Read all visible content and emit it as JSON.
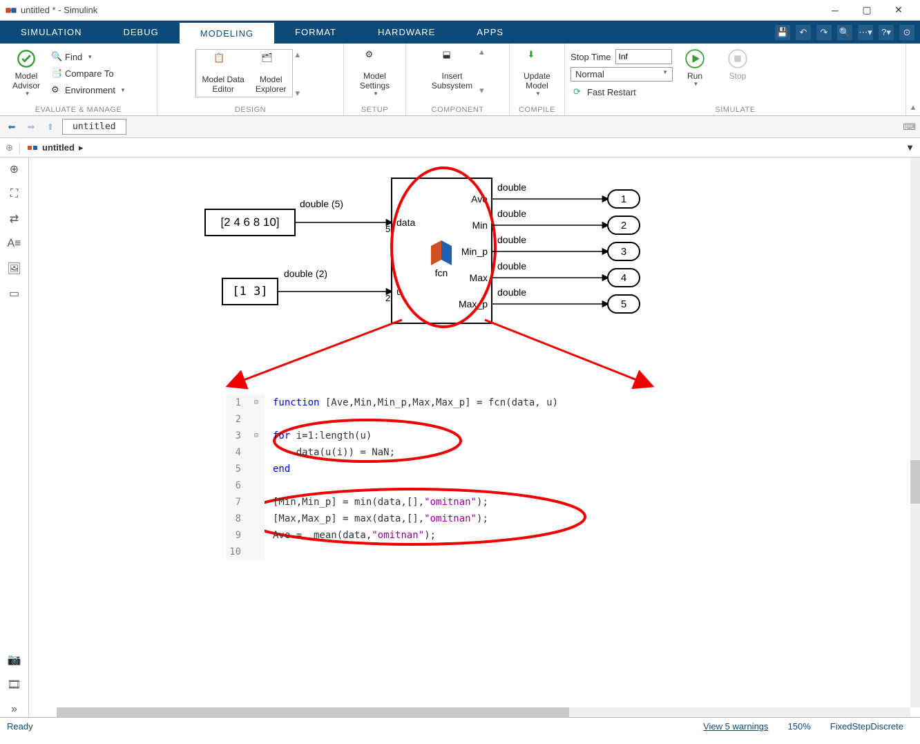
{
  "window": {
    "title": "untitled * - Simulink"
  },
  "tabs": [
    "SIMULATION",
    "DEBUG",
    "MODELING",
    "FORMAT",
    "HARDWARE",
    "APPS"
  ],
  "activeTab": "MODELING",
  "ribbon": {
    "evaluate": {
      "model_advisor": "Model\nAdvisor",
      "find": "Find",
      "compare": "Compare To",
      "environment": "Environment",
      "label": "EVALUATE & MANAGE"
    },
    "design": {
      "data_editor": "Model Data\nEditor",
      "explorer": "Model\nExplorer",
      "label": "DESIGN"
    },
    "setup": {
      "settings": "Model\nSettings",
      "label": "SETUP"
    },
    "component": {
      "insert": "Insert\nSubsystem",
      "label": "COMPONENT"
    },
    "compile": {
      "update": "Update\nModel",
      "label": "COMPILE"
    },
    "simulate": {
      "stoptime_label": "Stop Time",
      "stoptime_val": "Inf",
      "mode": "Normal",
      "fast": "Fast Restart",
      "run": "Run",
      "stop": "Stop",
      "label": "SIMULATE"
    }
  },
  "nav": {
    "tab": "untitled"
  },
  "breadcrumb": {
    "model": "untitled"
  },
  "diagram": {
    "const1": "[2 4 6 8 10]",
    "const1_sig": "double (5)",
    "const2": "[1 3]",
    "const2_sig": "double (2)",
    "fcn_name": "fcn",
    "in_labels": [
      "data",
      "u"
    ],
    "in_sizes": [
      "5",
      "2"
    ],
    "out_labels": [
      "Ave",
      "Min",
      "Min_p",
      "Max",
      "Max_p"
    ],
    "out_sig": "double",
    "outports": [
      "1",
      "2",
      "3",
      "4",
      "5"
    ]
  },
  "code": {
    "lines": [
      {
        "n": "1",
        "fold": "⊟",
        "t": "function [Ave,Min,Min_p,Max,Max_p] = fcn(data, u)"
      },
      {
        "n": "2",
        "fold": "",
        "t": ""
      },
      {
        "n": "3",
        "fold": "⊟",
        "t": "for i=1:length(u)"
      },
      {
        "n": "4",
        "fold": "",
        "t": "    data(u(i)) = NaN;"
      },
      {
        "n": "5",
        "fold": "",
        "t": "end"
      },
      {
        "n": "6",
        "fold": "",
        "t": ""
      },
      {
        "n": "7",
        "fold": "",
        "t": "[Min,Min_p] = min(data,[],\"omitnan\");"
      },
      {
        "n": "8",
        "fold": "",
        "t": "[Max,Max_p] = max(data,[],\"omitnan\");"
      },
      {
        "n": "9",
        "fold": "",
        "t": "Ave =  mean(data,\"omitnan\");"
      },
      {
        "n": "10",
        "fold": "",
        "t": ""
      }
    ]
  },
  "status": {
    "ready": "Ready",
    "warnings": "View 5 warnings",
    "zoom": "150%",
    "solver": "FixedStepDiscrete"
  },
  "chart_data": {
    "type": "table",
    "description": "MATLAB Function block: removes elements at indices u from data, then computes mean/min/max with omitnan.",
    "inputs": {
      "data": [
        2,
        4,
        6,
        8,
        10
      ],
      "u": [
        1,
        3
      ]
    },
    "outputs_defined": [
      "Ave",
      "Min",
      "Min_p",
      "Max",
      "Max_p"
    ]
  }
}
